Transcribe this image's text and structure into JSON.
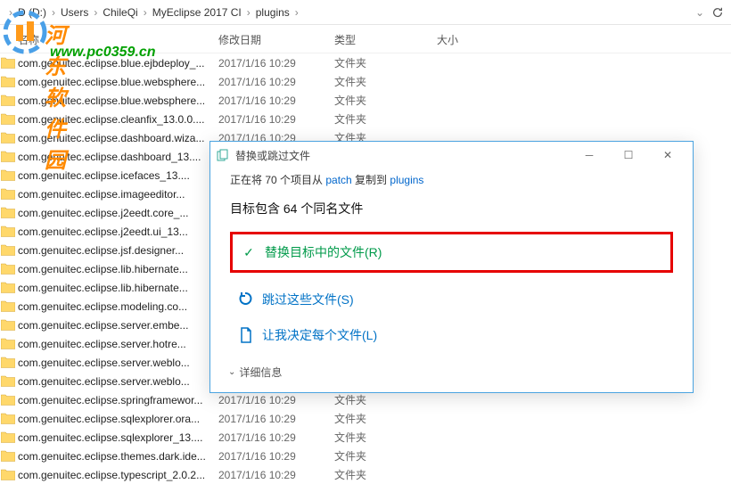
{
  "breadcrumb": {
    "items": [
      "D (D:)",
      "Users",
      "ChileQi",
      "MyEclipse 2017 CI",
      "plugins"
    ]
  },
  "columns": {
    "name": "名称",
    "date": "修改日期",
    "type": "类型",
    "size": "大小"
  },
  "files": [
    {
      "name": "com.genuitec.eclipse.blue.ejbdeploy_...",
      "date": "2017/1/16 10:29",
      "type": "文件夹"
    },
    {
      "name": "com.genuitec.eclipse.blue.websphere...",
      "date": "2017/1/16 10:29",
      "type": "文件夹"
    },
    {
      "name": "com.genuitec.eclipse.blue.websphere...",
      "date": "2017/1/16 10:29",
      "type": "文件夹"
    },
    {
      "name": "com.genuitec.eclipse.cleanfix_13.0.0....",
      "date": "2017/1/16 10:29",
      "type": "文件夹"
    },
    {
      "name": "com.genuitec.eclipse.dashboard.wiza...",
      "date": "2017/1/16 10:29",
      "type": "文件夹"
    },
    {
      "name": "com.genuitec.eclipse.dashboard_13....",
      "date": "",
      "type": ""
    },
    {
      "name": "com.genuitec.eclipse.icefaces_13....",
      "date": "",
      "type": ""
    },
    {
      "name": "com.genuitec.eclipse.imageeditor...",
      "date": "",
      "type": ""
    },
    {
      "name": "com.genuitec.eclipse.j2eedt.core_...",
      "date": "",
      "type": ""
    },
    {
      "name": "com.genuitec.eclipse.j2eedt.ui_13...",
      "date": "",
      "type": ""
    },
    {
      "name": "com.genuitec.eclipse.jsf.designer...",
      "date": "",
      "type": ""
    },
    {
      "name": "com.genuitec.eclipse.lib.hibernate...",
      "date": "",
      "type": ""
    },
    {
      "name": "com.genuitec.eclipse.lib.hibernate...",
      "date": "",
      "type": ""
    },
    {
      "name": "com.genuitec.eclipse.modeling.co...",
      "date": "",
      "type": ""
    },
    {
      "name": "com.genuitec.eclipse.server.embe...",
      "date": "",
      "type": ""
    },
    {
      "name": "com.genuitec.eclipse.server.hotre...",
      "date": "",
      "type": ""
    },
    {
      "name": "com.genuitec.eclipse.server.weblo...",
      "date": "",
      "type": ""
    },
    {
      "name": "com.genuitec.eclipse.server.weblo...",
      "date": "",
      "type": ""
    },
    {
      "name": "com.genuitec.eclipse.springframewor...",
      "date": "2017/1/16 10:29",
      "type": "文件夹"
    },
    {
      "name": "com.genuitec.eclipse.sqlexplorer.ora...",
      "date": "2017/1/16 10:29",
      "type": "文件夹"
    },
    {
      "name": "com.genuitec.eclipse.sqlexplorer_13....",
      "date": "2017/1/16 10:29",
      "type": "文件夹"
    },
    {
      "name": "com.genuitec.eclipse.themes.dark.ide...",
      "date": "2017/1/16 10:29",
      "type": "文件夹"
    },
    {
      "name": "com.genuitec.eclipse.typescript_2.0.2...",
      "date": "2017/1/16 10:29",
      "type": "文件夹"
    }
  ],
  "watermark": {
    "text": "河东软件园",
    "url": "www.pc0359.cn"
  },
  "dialog": {
    "title": "替换或跳过文件",
    "line1_a": "正在将 70 个项目从 ",
    "line1_src": "patch",
    "line1_b": " 复制到 ",
    "line1_dst": "plugins",
    "line2": "目标包含 64 个同名文件",
    "opt_replace": "替换目标中的文件(R)",
    "opt_skip": "跳过这些文件(S)",
    "opt_decide": "让我决定每个文件(L)",
    "details": "详细信息"
  }
}
